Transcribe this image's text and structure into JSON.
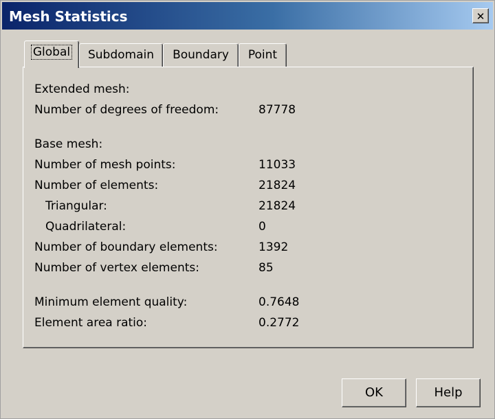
{
  "window": {
    "title": "Mesh Statistics",
    "close_glyph": "✕"
  },
  "tabs": [
    {
      "label": "Global",
      "active": true
    },
    {
      "label": "Subdomain",
      "active": false
    },
    {
      "label": "Boundary",
      "active": false
    },
    {
      "label": "Point",
      "active": false
    }
  ],
  "extended": {
    "heading": "Extended mesh:",
    "dof_label": "Number of degrees of freedom:",
    "dof_value": "87778"
  },
  "base": {
    "heading": "Base mesh:",
    "rows": [
      {
        "label": "Number of mesh points:",
        "value": "11033"
      },
      {
        "label": "Number of elements:",
        "value": "21824"
      },
      {
        "label": "Triangular:",
        "value": "21824"
      },
      {
        "label": "Quadrilateral:",
        "value": "0"
      },
      {
        "label": "Number of boundary elements:",
        "value": "1392"
      },
      {
        "label": "Number of vertex elements:",
        "value": "85"
      }
    ]
  },
  "quality": {
    "rows": [
      {
        "label": "Minimum element quality:",
        "value": "0.7648"
      },
      {
        "label": "Element area ratio:",
        "value": "0.2772"
      }
    ]
  },
  "buttons": {
    "ok": "OK",
    "help": "Help"
  }
}
